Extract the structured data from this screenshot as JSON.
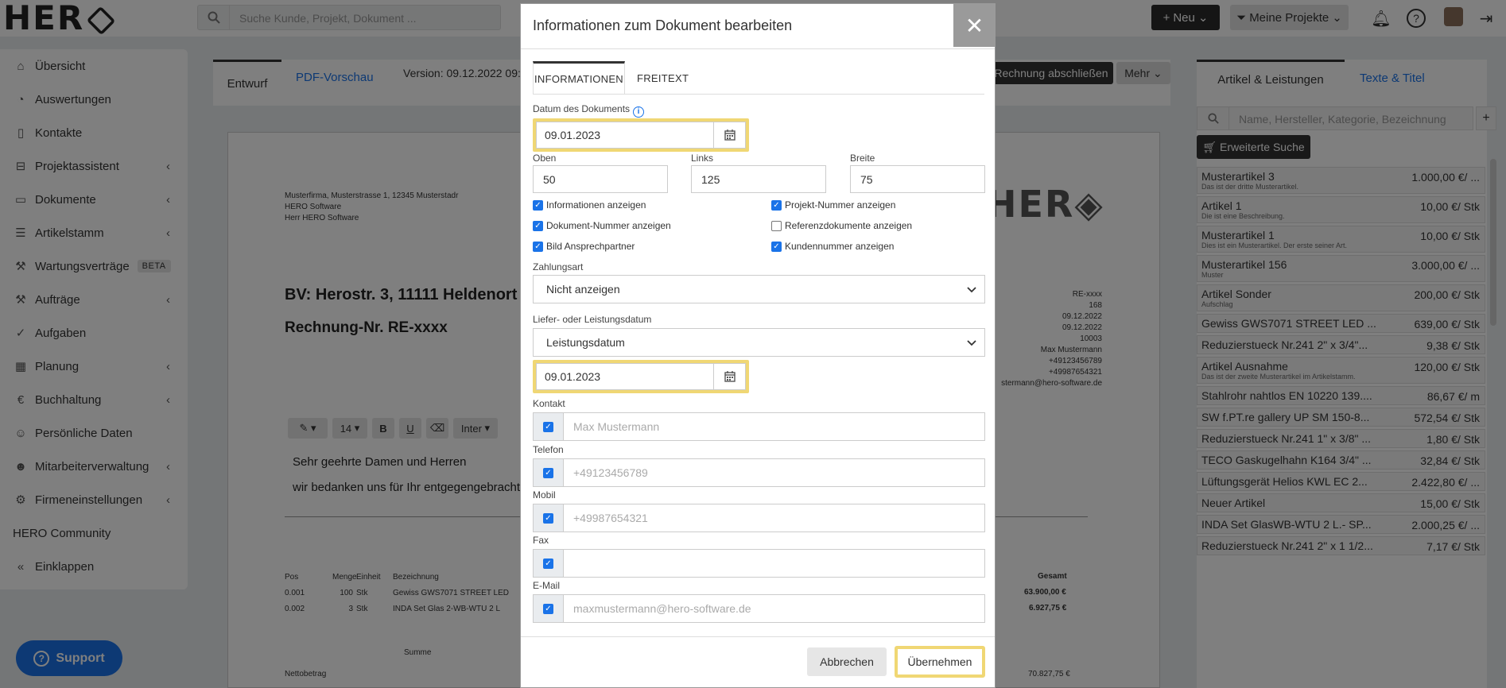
{
  "header": {
    "search_placeholder": "Suche Kunde, Projekt, Dokument ...",
    "new_label": "Neu",
    "projects_label": "Meine Projekte"
  },
  "sidebar": {
    "items": [
      {
        "label": "Übersicht"
      },
      {
        "label": "Auswertungen"
      },
      {
        "label": "Kontakte"
      },
      {
        "label": "Projektassistent"
      },
      {
        "label": "Dokumente"
      },
      {
        "label": "Artikelstamm"
      },
      {
        "label": "Wartungsverträge",
        "badge": "BETA"
      },
      {
        "label": "Aufträge"
      },
      {
        "label": "Aufgaben"
      },
      {
        "label": "Planung"
      },
      {
        "label": "Buchhaltung"
      },
      {
        "label": "Persönliche Daten"
      },
      {
        "label": "Mitarbeiterverwaltung"
      },
      {
        "label": "Firmeneinstellungen"
      },
      {
        "label": "HERO Community"
      },
      {
        "label": "Einklappen"
      }
    ],
    "support_label": "Support"
  },
  "editor": {
    "tab_draft": "Entwurf",
    "tab_pdf": "PDF-Vorschau",
    "version": "Version: 09.12.2022 09:2",
    "finish_button": "Rechnung abschließen",
    "more_button": "Mehr",
    "address_lines": [
      "Musterfirma, Musterstrasse 1, 12345 Musterstadr",
      "HERO Software",
      "Herr HERO Software"
    ],
    "bv": "BV: Herostr. 3, 11111 Heldenort",
    "rechnung": "Rechnung-Nr. RE-xxxx",
    "meta_lines": [
      "RE-xxxx",
      "168",
      "09.12.2022",
      "09.12.2022",
      "10003",
      "Max Mustermann",
      "+49123456789",
      "+49987654321",
      "stermann@hero-software.de"
    ],
    "font_size": "14",
    "font_family": "Inter",
    "greeting": "Sehr geehrte Damen und Herren",
    "greeting2": "wir bedanken uns für Ihr entgegengebracht",
    "table_headers": [
      "Pos",
      "Menge",
      "Einheit",
      "Bezeichnung"
    ],
    "table_rows": [
      [
        "0.001",
        "100",
        "Stk",
        "Gewiss GWS7071 STREET LED"
      ],
      [
        "0.002",
        "3",
        "Stk",
        "INDA Set Glas 2-WB-WTU 2 L"
      ]
    ],
    "total_header": "Gesamt",
    "total_values": [
      "63.900,00 €",
      "6.927,75 €"
    ],
    "summe": "Summe",
    "netto": "Nettobetrag",
    "netto_value": "70.827,75 €"
  },
  "right_panel": {
    "tab_articles": "Artikel & Leistungen",
    "tab_texts": "Texte & Titel",
    "search_placeholder": "Name, Hersteller, Kategorie, Bezeichnung",
    "ext_search": "Erweiterte Suche",
    "items": [
      {
        "name": "Musterartikel 3",
        "desc": "Das ist der dritte Musterartikel.",
        "price": "1.000,00 €/ ..."
      },
      {
        "name": "Artikel 1",
        "desc": "Die ist eine Beschreibung.",
        "price": "10,00 €/ Stk"
      },
      {
        "name": "Musterartikel 1",
        "desc": "Dies ist ein Musterartikel. Der erste seiner Art.",
        "price": "10,00 €/ Stk"
      },
      {
        "name": "Musterartikel 156",
        "desc": "Muster",
        "price": "3.000,00 €/ ..."
      },
      {
        "name": "Artikel Sonder",
        "desc": "Aufschlag",
        "price": "200,00 €/ Stk"
      },
      {
        "name": "Gewiss GWS7071 STREET LED ...",
        "desc": "",
        "price": "639,00 €/ Stk"
      },
      {
        "name": "Reduzierstueck Nr.241 2\" x 3/4\"...",
        "desc": "",
        "price": "9,38 €/ Stk"
      },
      {
        "name": "Artikel Ausnahme",
        "desc": "Das ist der zweite Musterartikel im Artikelstamm.",
        "price": "120,00 €/ Stk"
      },
      {
        "name": "Stahlrohr nahtlos EN 10220 139....",
        "desc": "",
        "price": "86,67 €/ m"
      },
      {
        "name": "SW f.PT.re gallery UP SM 150-8...",
        "desc": "",
        "price": "572,54 €/ Stk"
      },
      {
        "name": "Reduzierstueck Nr.241 1\" x 3/8\" ...",
        "desc": "",
        "price": "1,80 €/ Stk"
      },
      {
        "name": "TECO Gaskugelhahn K164 3/4\" ...",
        "desc": "",
        "price": "32,84 €/ Stk"
      },
      {
        "name": "Lüftungsgerät Helios KWL EC 2...",
        "desc": "",
        "price": "2.422,80 €/ ..."
      },
      {
        "name": "Neuer Artikel",
        "desc": "",
        "price": "15,00 €/ Stk"
      },
      {
        "name": "INDA Set GlasWB-WTU 2 L.- SP...",
        "desc": "",
        "price": "2.000,25 €/ ..."
      },
      {
        "name": "Reduzierstueck Nr.241 2\" x 1 1/2...",
        "desc": "",
        "price": "7,17 €/ Stk"
      }
    ]
  },
  "modal": {
    "title": "Informationen zum Dokument bearbeiten",
    "tab_info": "INFORMATIONEN",
    "tab_text": "FREITEXT",
    "date_label": "Datum des Dokuments",
    "date_value": "09.01.2023",
    "oben_label": "Oben",
    "oben_value": "50",
    "links_label": "Links",
    "links_value": "125",
    "breite_label": "Breite",
    "breite_value": "75",
    "checkboxes": [
      {
        "label": "Informationen anzeigen",
        "checked": true
      },
      {
        "label": "Projekt-Nummer anzeigen",
        "checked": true
      },
      {
        "label": "Dokument-Nummer anzeigen",
        "checked": true
      },
      {
        "label": "Referenzdokumente anzeigen",
        "checked": false
      },
      {
        "label": "Bild Ansprechpartner",
        "checked": true
      },
      {
        "label": "Kundennummer anzeigen",
        "checked": true
      }
    ],
    "payment_label": "Zahlungsart",
    "payment_value": "Nicht anzeigen",
    "delivery_label": "Liefer- oder Leistungsdatum",
    "delivery_value": "Leistungsdatum",
    "delivery_date": "09.01.2023",
    "contact_fields": [
      {
        "label": "Kontakt",
        "value": "Max Mustermann"
      },
      {
        "label": "Telefon",
        "value": "+49123456789"
      },
      {
        "label": "Mobil",
        "value": "+49987654321"
      },
      {
        "label": "Fax",
        "value": ""
      },
      {
        "label": "E-Mail",
        "value": "maxmustermann@hero-software.de"
      }
    ],
    "cancel_label": "Abbrechen",
    "apply_label": "Übernehmen"
  }
}
